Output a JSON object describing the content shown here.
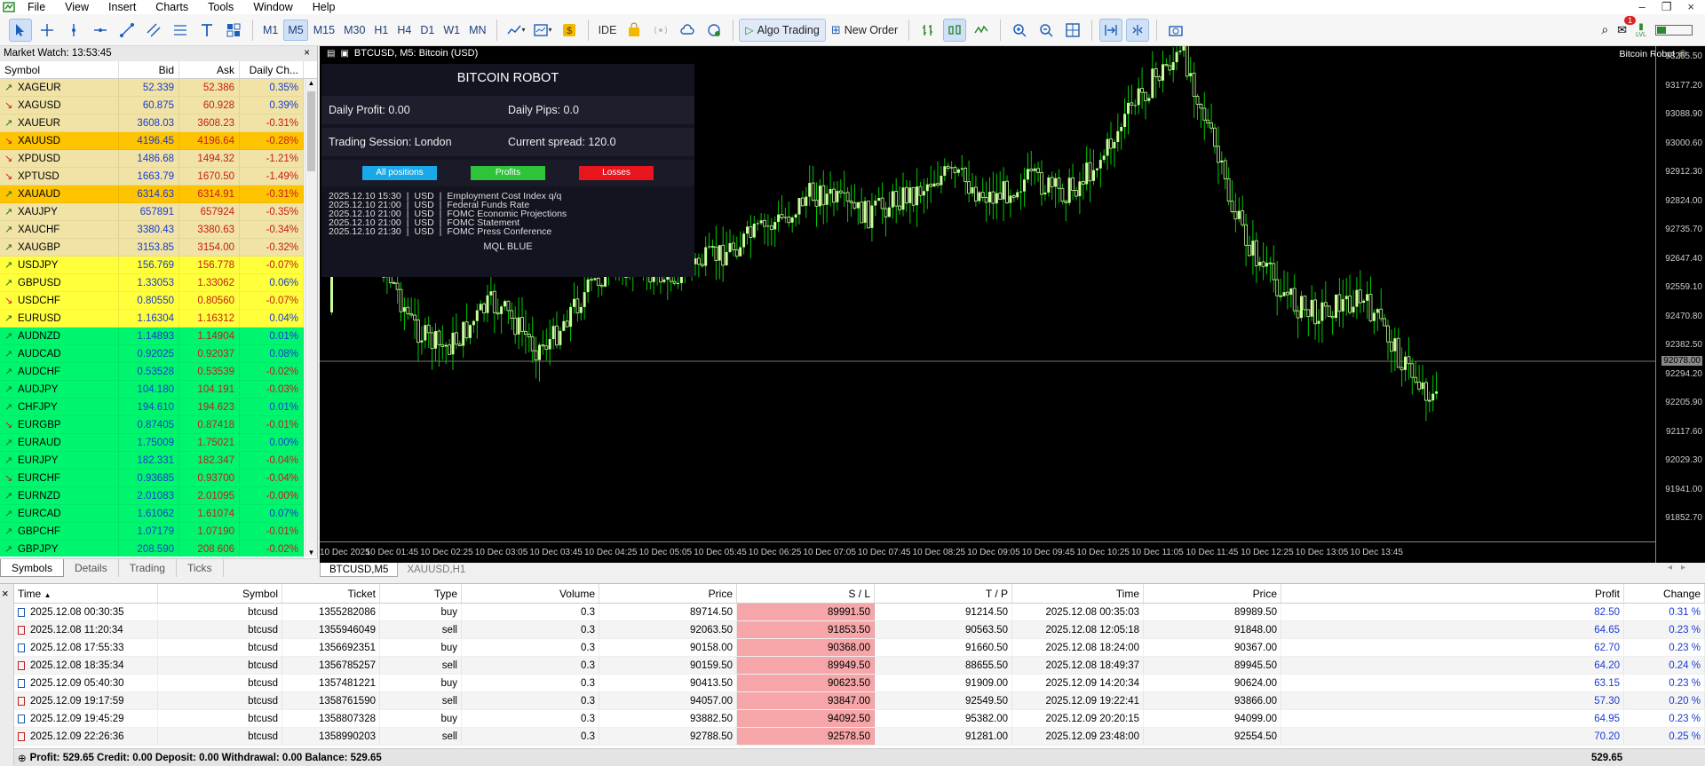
{
  "menu": [
    "File",
    "View",
    "Insert",
    "Charts",
    "Tools",
    "Window",
    "Help"
  ],
  "toolbar": {
    "timeframes": [
      "M1",
      "M5",
      "M15",
      "M30",
      "H1",
      "H4",
      "D1",
      "W1",
      "MN"
    ],
    "selected_tf": "M5",
    "ide": "IDE",
    "algo_trading": "Algo Trading",
    "new_order": "New Order",
    "notif_count": "1",
    "lvl": "LVL"
  },
  "market_watch": {
    "title": "Market Watch: 13:53:45",
    "close": "×",
    "headers": {
      "symbol": "Symbol",
      "bid": "Bid",
      "ask": "Ask",
      "change": "Daily Ch..."
    },
    "rows": [
      {
        "sym": "XAGEUR",
        "bid": "52.339",
        "ask": "52.386",
        "ch": "0.35%",
        "dir": "up",
        "bg": "#f0e3a5"
      },
      {
        "sym": "XAGUSD",
        "bid": "60.875",
        "ask": "60.928",
        "ch": "0.39%",
        "dir": "down",
        "bg": "#f0e3a5"
      },
      {
        "sym": "XAUEUR",
        "bid": "3608.03",
        "ask": "3608.23",
        "ch": "-0.31%",
        "dir": "up",
        "bg": "#f0e3a5"
      },
      {
        "sym": "XAUUSD",
        "bid": "4196.45",
        "ask": "4196.64",
        "ch": "-0.28%",
        "dir": "down",
        "bg": "#ffc400"
      },
      {
        "sym": "XPDUSD",
        "bid": "1486.68",
        "ask": "1494.32",
        "ch": "-1.21%",
        "dir": "down",
        "bg": "#f0e3a5"
      },
      {
        "sym": "XPTUSD",
        "bid": "1663.79",
        "ask": "1670.50",
        "ch": "-1.49%",
        "dir": "down",
        "bg": "#f0e3a5"
      },
      {
        "sym": "XAUAUD",
        "bid": "6314.63",
        "ask": "6314.91",
        "ch": "-0.31%",
        "dir": "up",
        "bg": "#ffc400"
      },
      {
        "sym": "XAUJPY",
        "bid": "657891",
        "ask": "657924",
        "ch": "-0.35%",
        "dir": "up",
        "bg": "#f0e3a5"
      },
      {
        "sym": "XAUCHF",
        "bid": "3380.43",
        "ask": "3380.63",
        "ch": "-0.34%",
        "dir": "up",
        "bg": "#f0e3a5"
      },
      {
        "sym": "XAUGBP",
        "bid": "3153.85",
        "ask": "3154.00",
        "ch": "-0.32%",
        "dir": "up",
        "bg": "#f0e3a5"
      },
      {
        "sym": "USDJPY",
        "bid": "156.769",
        "ask": "156.778",
        "ch": "-0.07%",
        "dir": "up",
        "bg": "#ffff3c"
      },
      {
        "sym": "GBPUSD",
        "bid": "1.33053",
        "ask": "1.33062",
        "ch": "0.06%",
        "dir": "up",
        "bg": "#ffff3c"
      },
      {
        "sym": "USDCHF",
        "bid": "0.80550",
        "ask": "0.80560",
        "ch": "-0.07%",
        "dir": "down",
        "bg": "#ffff3c"
      },
      {
        "sym": "EURUSD",
        "bid": "1.16304",
        "ask": "1.16312",
        "ch": "0.04%",
        "dir": "up",
        "bg": "#ffff3c"
      },
      {
        "sym": "AUDNZD",
        "bid": "1.14893",
        "ask": "1.14904",
        "ch": "0.01%",
        "dir": "up",
        "bg": "#00f56e"
      },
      {
        "sym": "AUDCAD",
        "bid": "0.92025",
        "ask": "0.92037",
        "ch": "0.08%",
        "dir": "up",
        "bg": "#00f56e"
      },
      {
        "sym": "AUDCHF",
        "bid": "0.53528",
        "ask": "0.53539",
        "ch": "-0.02%",
        "dir": "up",
        "bg": "#00f56e"
      },
      {
        "sym": "AUDJPY",
        "bid": "104.180",
        "ask": "104.191",
        "ch": "-0.03%",
        "dir": "up",
        "bg": "#00f56e"
      },
      {
        "sym": "CHFJPY",
        "bid": "194.610",
        "ask": "194.623",
        "ch": "0.01%",
        "dir": "up",
        "bg": "#00f56e"
      },
      {
        "sym": "EURGBP",
        "bid": "0.87405",
        "ask": "0.87418",
        "ch": "-0.01%",
        "dir": "down",
        "bg": "#00f56e"
      },
      {
        "sym": "EURAUD",
        "bid": "1.75009",
        "ask": "1.75021",
        "ch": "0.00%",
        "dir": "up",
        "bg": "#00f56e"
      },
      {
        "sym": "EURJPY",
        "bid": "182.331",
        "ask": "182.347",
        "ch": "-0.04%",
        "dir": "up",
        "bg": "#00f56e"
      },
      {
        "sym": "EURCHF",
        "bid": "0.93685",
        "ask": "0.93700",
        "ch": "-0.04%",
        "dir": "down",
        "bg": "#00f56e"
      },
      {
        "sym": "EURNZD",
        "bid": "2.01083",
        "ask": "2.01095",
        "ch": "-0.00%",
        "dir": "up",
        "bg": "#00f56e"
      },
      {
        "sym": "EURCAD",
        "bid": "1.61062",
        "ask": "1.61074",
        "ch": "0.07%",
        "dir": "up",
        "bg": "#00f56e"
      },
      {
        "sym": "GBPCHF",
        "bid": "1.07179",
        "ask": "1.07190",
        "ch": "-0.01%",
        "dir": "up",
        "bg": "#00f56e"
      },
      {
        "sym": "GBPJPY",
        "bid": "208.590",
        "ask": "208.606",
        "ch": "-0.02%",
        "dir": "up",
        "bg": "#00f56e"
      }
    ],
    "tabs": [
      "Symbols",
      "Details",
      "Trading",
      "Ticks"
    ]
  },
  "chart": {
    "title": "BTCUSD, M5:  Bitcoin (USD)",
    "robot": "Bitcoin Robot",
    "price_ticks": [
      "93265.50",
      "93177.20",
      "93088.90",
      "93000.60",
      "92912.30",
      "92824.00",
      "92735.70",
      "92647.40",
      "92559.10",
      "92470.80",
      "92382.50",
      "92294.20",
      "92205.90",
      "92117.60",
      "92029.30",
      "91941.00",
      "91852.70"
    ],
    "current_price": "92078.00",
    "time_ticks": [
      "10 Dec 2025",
      "10 Dec 01:45",
      "10 Dec 02:25",
      "10 Dec 03:05",
      "10 Dec 03:45",
      "10 Dec 04:25",
      "10 Dec 05:05",
      "10 Dec 05:45",
      "10 Dec 06:25",
      "10 Dec 07:05",
      "10 Dec 07:45",
      "10 Dec 08:25",
      "10 Dec 09:05",
      "10 Dec 09:45",
      "10 Dec 10:25",
      "10 Dec 11:05",
      "10 Dec 11:45",
      "10 Dec 12:25",
      "10 Dec 13:05",
      "10 Dec 13:45"
    ],
    "bull_color": "#c8ff9a",
    "wick_color": "#00c800"
  },
  "panel": {
    "title": "BITCOIN ROBOT",
    "daily_profit": "Daily Profit: 0.00",
    "daily_pips": "Daily Pips:  0.0",
    "session": "Trading Session: London",
    "spread": "Current spread:  120.0",
    "btn_all": "All positions",
    "btn_profits": "Profits",
    "btn_losses": "Losses",
    "news": [
      {
        "time": "2025.12.10 15:30",
        "cur": "USD",
        "ev": "Employment Cost Index q/q"
      },
      {
        "time": "2025.12.10 21:00",
        "cur": "USD",
        "ev": "Federal Funds Rate"
      },
      {
        "time": "2025.12.10 21:00",
        "cur": "USD",
        "ev": "FOMC Economic Projections"
      },
      {
        "time": "2025.12.10 21:00",
        "cur": "USD",
        "ev": "FOMC Statement"
      },
      {
        "time": "2025.12.10 21:30",
        "cur": "USD",
        "ev": "FOMC Press Conference"
      }
    ],
    "footer": "MQL BLUE"
  },
  "chart_tabs": [
    "BTCUSD,M5",
    "XAUUSD,H1"
  ],
  "terminal": {
    "headers": [
      "Time",
      "Symbol",
      "Ticket",
      "Type",
      "Volume",
      "Price",
      "S / L",
      "T / P",
      "Time",
      "Price",
      "Profit",
      "Change"
    ],
    "rows": [
      [
        "2025.12.08 00:30:35",
        "btcusd",
        "1355282086",
        "buy",
        "0.3",
        "89714.50",
        "89991.50",
        "91214.50",
        "2025.12.08 00:35:03",
        "89989.50",
        "82.50",
        "0.31 %"
      ],
      [
        "2025.12.08 11:20:34",
        "btcusd",
        "1355946049",
        "sell",
        "0.3",
        "92063.50",
        "91853.50",
        "90563.50",
        "2025.12.08 12:05:18",
        "91848.00",
        "64.65",
        "0.23 %"
      ],
      [
        "2025.12.08 17:55:33",
        "btcusd",
        "1356692351",
        "buy",
        "0.3",
        "90158.00",
        "90368.00",
        "91660.50",
        "2025.12.08 18:24:00",
        "90367.00",
        "62.70",
        "0.23 %"
      ],
      [
        "2025.12.08 18:35:34",
        "btcusd",
        "1356785257",
        "sell",
        "0.3",
        "90159.50",
        "89949.50",
        "88655.50",
        "2025.12.08 18:49:37",
        "89945.50",
        "64.20",
        "0.24 %"
      ],
      [
        "2025.12.09 05:40:30",
        "btcusd",
        "1357481221",
        "buy",
        "0.3",
        "90413.50",
        "90623.50",
        "91909.00",
        "2025.12.09 14:20:34",
        "90624.00",
        "63.15",
        "0.23 %"
      ],
      [
        "2025.12.09 19:17:59",
        "btcusd",
        "1358761590",
        "sell",
        "0.3",
        "94057.00",
        "93847.00",
        "92549.50",
        "2025.12.09 19:22:41",
        "93866.00",
        "57.30",
        "0.20 %"
      ],
      [
        "2025.12.09 19:45:29",
        "btcusd",
        "1358807328",
        "buy",
        "0.3",
        "93882.50",
        "94092.50",
        "95382.00",
        "2025.12.09 20:20:15",
        "94099.00",
        "64.95",
        "0.23 %"
      ],
      [
        "2025.12.09 22:26:36",
        "btcusd",
        "1358990203",
        "sell",
        "0.3",
        "92788.50",
        "92578.50",
        "91281.00",
        "2025.12.09 23:48:00",
        "92554.50",
        "70.20",
        "0.25 %"
      ]
    ],
    "footer": "Profit: 529.65  Credit: 0.00  Deposit: 0.00  Withdrawal: 0.00  Balance: 529.65",
    "total": "529.65"
  }
}
